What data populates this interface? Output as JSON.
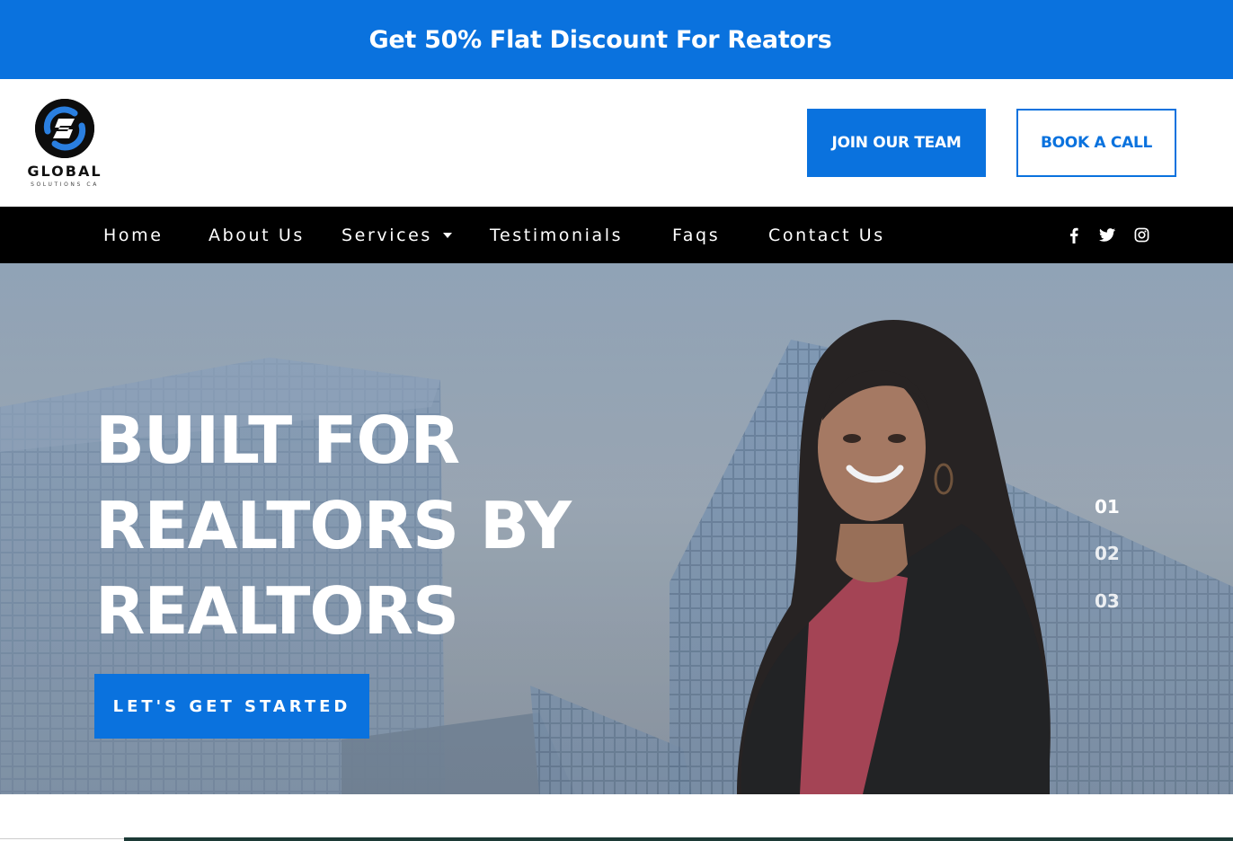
{
  "promo": {
    "text": "Get 50% Flat Discount For Reators"
  },
  "header": {
    "logo_word": "GLOBAL",
    "logo_sub": "SOLUTIONS CA",
    "join_label": "JOIN OUR TEAM",
    "book_label": "BOOK A CALL"
  },
  "nav": {
    "items": [
      {
        "label": "Home"
      },
      {
        "label": "About Us"
      },
      {
        "label": "Services"
      },
      {
        "label": "Testimonials"
      },
      {
        "label": "Faqs"
      },
      {
        "label": "Contact Us"
      }
    ],
    "social_icons": [
      "facebook-icon",
      "twitter-icon",
      "instagram-icon"
    ]
  },
  "hero": {
    "heading_line1": "BUILT FOR",
    "heading_line2": "REALTORS BY",
    "heading_line3": "REALTORS",
    "cta_label": "LET'S GET STARTED",
    "slides": [
      "01",
      "02",
      "03"
    ]
  },
  "colors": {
    "brand_blue": "#0a72de",
    "nav_bg": "#000000"
  }
}
